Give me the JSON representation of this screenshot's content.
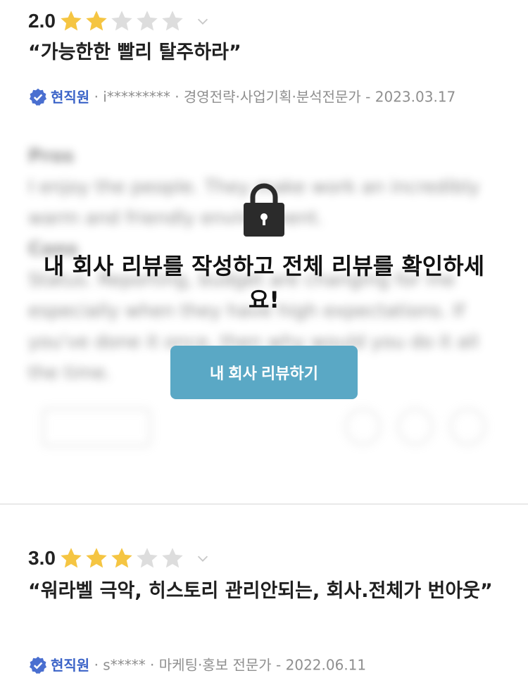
{
  "reviews": [
    {
      "rating": "2.0",
      "stars_filled": 2,
      "stars_total": 5,
      "title": "“가능한한 빨리 탈주하라”",
      "verified_label": "현직원",
      "meta_text": "· i********* · 경영전략·사업기획·분석전문가 - 2023.03.17",
      "blurred": {
        "lines": [
          "Pros",
          "I enjoy the people. They make work an incredibly",
          "warm and friendly environment.",
          "Cons",
          "Status. Reporting, budget are changing for me",
          "especially when they have high expectations. If",
          "you've done it once, then why would you do it all",
          "the time."
        ]
      }
    },
    {
      "rating": "3.0",
      "stars_filled": 3,
      "stars_total": 5,
      "title": "“워라벨 극악, 히스토리 관리안되는, 회사.전체가 번아웃”",
      "verified_label": "현직원",
      "meta_text": "· s***** · 마케팅·홍보 전문가 - 2022.06.11"
    }
  ],
  "lock_overlay": {
    "message": "내 회사 리뷰를 작성하고 전체 리뷰를 확인하세요!",
    "button_label": "내 회사 리뷰하기",
    "icon": "lock-icon"
  },
  "colors": {
    "star_filled": "#f5c542",
    "star_empty": "#dddddd",
    "verified": "#3c64c8",
    "cta_bg": "#5aa8c5"
  }
}
